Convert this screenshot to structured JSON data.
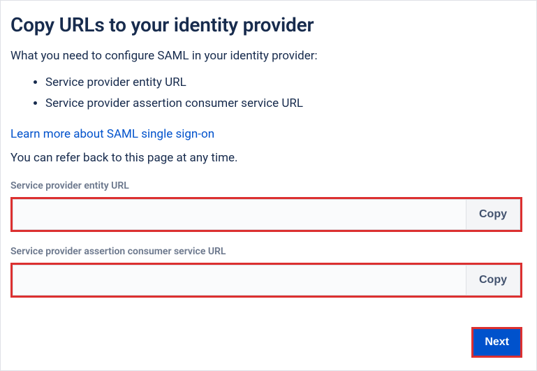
{
  "heading": "Copy URLs to your identity provider",
  "intro": "What you need to configure SAML in your identity provider:",
  "bullets": {
    "item0": "Service provider entity URL",
    "item1": "Service provider assertion consumer service URL"
  },
  "learnMore": "Learn more about SAML single sign-on",
  "referText": "You can refer back to this page at any time.",
  "fields": {
    "entity": {
      "label": "Service provider entity URL",
      "value": "",
      "copy": "Copy"
    },
    "acs": {
      "label": "Service provider assertion consumer service URL",
      "value": "",
      "copy": "Copy"
    }
  },
  "nextLabel": "Next"
}
